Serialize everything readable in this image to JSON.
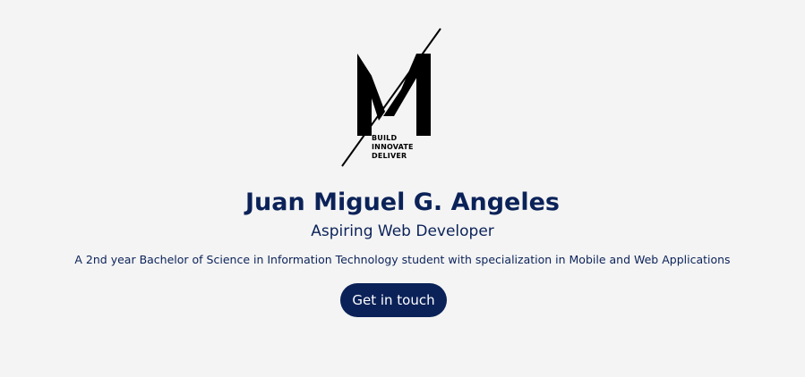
{
  "logo": {
    "tagline_lines": [
      "BUILD",
      "INNOVATE",
      "DELIVER"
    ]
  },
  "profile": {
    "name": "Juan Miguel G. Angeles",
    "role": "Aspiring Web Developer",
    "description": "A 2nd year Bachelor of Science in Information Technology student with specialization in Mobile and Web Applications"
  },
  "cta": {
    "label": "Get in touch"
  },
  "colors": {
    "background": "#f4f4f4",
    "accent": "#0b2259",
    "logo": "#000000",
    "button_text": "#ffffff"
  }
}
